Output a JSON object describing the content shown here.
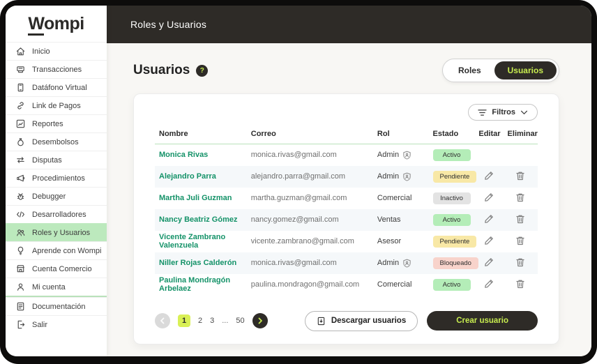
{
  "top_bar": {
    "title": "Roles y Usuarios"
  },
  "sidebar": {
    "logo_w": "W",
    "logo_rest": "ompi",
    "items": [
      {
        "label": "Inicio",
        "icon": "home-icon"
      },
      {
        "label": "Transacciones",
        "icon": "transactions-icon"
      },
      {
        "label": "Datáfono Virtual",
        "icon": "virtual-terminal-icon"
      },
      {
        "label": "Link de Pagos",
        "icon": "payment-link-icon"
      },
      {
        "label": "Reportes",
        "icon": "reports-icon"
      },
      {
        "label": "Desembolsos",
        "icon": "disbursements-icon"
      },
      {
        "label": "Disputas",
        "icon": "disputes-icon"
      },
      {
        "label": "Procedimientos",
        "icon": "procedures-icon"
      },
      {
        "label": "Debugger",
        "icon": "debugger-icon"
      },
      {
        "label": "Desarrolladores",
        "icon": "developers-icon"
      },
      {
        "label": "Roles y Usuarios",
        "icon": "roles-users-icon"
      },
      {
        "label": "Aprende con Wompi",
        "icon": "lightbulb-icon"
      },
      {
        "label": "Cuenta Comercio",
        "icon": "store-icon"
      },
      {
        "label": "Mi cuenta",
        "icon": "account-icon"
      },
      {
        "label": "Documentación",
        "icon": "docs-icon"
      },
      {
        "label": "Salir",
        "icon": "logout-icon"
      }
    ],
    "active_item": "Roles y Usuarios"
  },
  "page": {
    "title": "Usuarios",
    "help_icon": "?",
    "toggle": {
      "roles_label": "Roles",
      "usuarios_label": "Usuarios",
      "selected": "Usuarios"
    },
    "filters_label": "Filtros"
  },
  "table": {
    "headers": [
      "Nombre",
      "Correo",
      "Rol",
      "Estado",
      "Editar",
      "Eliminar"
    ],
    "rows": [
      {
        "name": "Monica Rivas",
        "email": "monica.rivas@gmail.com",
        "role": "Admin",
        "admin_shield": true,
        "status": "Activo",
        "status_type": "active",
        "editable": false
      },
      {
        "name": "Alejandro Parra",
        "email": "alejandro.parra@gmail.com",
        "role": "Admin",
        "admin_shield": true,
        "status": "Pendiente",
        "status_type": "pending",
        "editable": true
      },
      {
        "name": "Martha Juli Guzman",
        "email": "martha.guzman@gmail.com",
        "role": "Comercial",
        "admin_shield": false,
        "status": "Inactivo",
        "status_type": "inactive",
        "editable": true
      },
      {
        "name": "Nancy Beatriz Gómez",
        "email": "nancy.gomez@gmail.com",
        "role": "Ventas",
        "admin_shield": false,
        "status": "Activo",
        "status_type": "active",
        "editable": true
      },
      {
        "name": "Vicente Zambrano Valenzuela",
        "email": "vicente.zambrano@gmail.com",
        "role": "Asesor",
        "admin_shield": false,
        "status": "Pendiente",
        "status_type": "pending",
        "editable": true
      },
      {
        "name": "Niller Rojas Calderón",
        "email": "monica.rivas@gmail.com",
        "role": "Admin",
        "admin_shield": true,
        "status": "Bloqueado",
        "status_type": "blocked",
        "editable": true
      },
      {
        "name": "Paulina Mondragón Arbelaez",
        "email": "paulina.mondragon@gmail.com",
        "role": "Comercial",
        "admin_shield": false,
        "status": "Activo",
        "status_type": "active",
        "editable": true
      }
    ]
  },
  "pagination": {
    "pages": [
      "1",
      "2",
      "3",
      "...",
      "50"
    ],
    "active_page": "1",
    "prev_icon": "chevron-left-icon",
    "next_icon": "chevron-right-icon"
  },
  "actions": {
    "download_label": "Descargar usuarios",
    "download_icon": "download-file-icon",
    "create_label": "Crear usuario"
  },
  "colors": {
    "accent-lime": "#c7ec4f",
    "dark": "#2e2b27",
    "sidebar-active-bg": "#bce9bd",
    "name-green": "#149268",
    "badge-active-bg": "#b4edb8",
    "badge-pending-bg": "#f8e8a6",
    "badge-inactive-bg": "#e3e3e3",
    "badge-blocked-bg": "#f8d3cb",
    "page-active-bg": "#d9f056",
    "header-divider-green": "#b9e2ba",
    "row-alt-bg": "#f5f8fa"
  }
}
